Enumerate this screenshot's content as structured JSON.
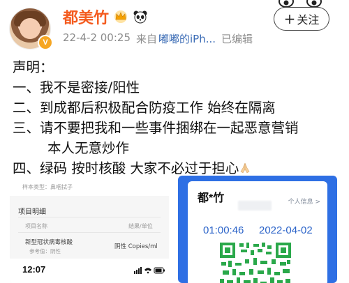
{
  "header": {
    "username": "都美竹",
    "timestamp": "22-4-2 00:25",
    "source_prefix": "来自",
    "device": "嘟嘟的iPh...",
    "edited": "已编辑",
    "follow_label": "关注"
  },
  "post": {
    "lines": [
      "声明：",
      "一、我不是密接/阳性",
      "二、到成都后积极配合防疫工作 始终在隔离",
      "三、请不要把我和一些事件捆绑在一起恶意营销",
      "本人无意炒作",
      "四、绿码 按时核酸 大家不必过于担心"
    ],
    "emoji": "praying-hands-icon"
  },
  "left_image": {
    "sample_type": "样本类型：鼻咽拭子",
    "section_title": "项目明细",
    "col_item": "项目名称",
    "col_result": "结果/单位",
    "item_name": "新型冠状病毒核酸",
    "item_ref": "参考值：阴性",
    "item_result": "阴性 Copies/ml",
    "phone_time": "12:07"
  },
  "right_image": {
    "name": "都*竹",
    "info_link": "个人信息 >",
    "time": "01:00:46",
    "date": "2022-04-02",
    "code_color": "#2aa84a",
    "frame_color": "#2e6fe4"
  },
  "colors": {
    "username": "#f45b1f",
    "meta": "#8c8c8c",
    "device_link": "#3a6bb5",
    "vip_badge": "#f6a623"
  }
}
